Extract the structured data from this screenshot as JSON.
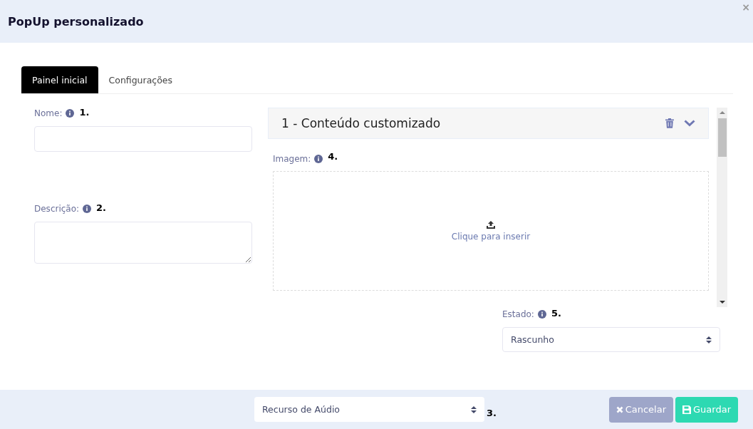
{
  "window": {
    "title": "PopUp personalizado",
    "close": "×"
  },
  "tabs": [
    {
      "label": "Painel inicial",
      "selected": true
    },
    {
      "label": "Configurações",
      "selected": false
    }
  ],
  "fields": [
    {
      "label": "Nome:",
      "marker": "1.",
      "kind": "input"
    },
    {
      "label": "Descrição:",
      "marker": "2.",
      "kind": "textarea"
    }
  ],
  "content_card": {
    "title": "1 - Conteúdo customizado",
    "image": {
      "label": "Imagem:",
      "marker": "4.",
      "upload_text": "Clique para inserir"
    }
  },
  "status": {
    "label": "Estado:",
    "marker": "5.",
    "value": "Rascunho"
  },
  "footer": {
    "resource_select": "Recurso de Aúdio",
    "marker": "3.",
    "buttons": [
      {
        "label": "Cancelar",
        "kind": "cancel"
      },
      {
        "label": "Guardar",
        "kind": "save"
      }
    ]
  }
}
